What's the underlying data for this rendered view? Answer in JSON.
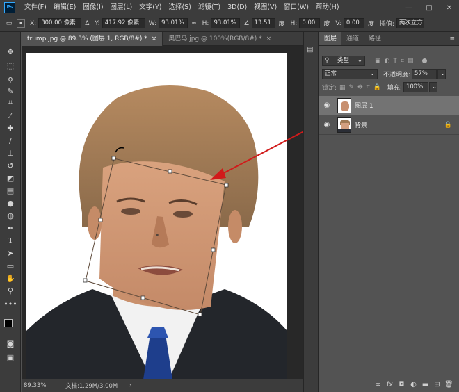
{
  "app": {
    "logo": "Ps"
  },
  "menu": [
    "文件(F)",
    "编辑(E)",
    "图像(I)",
    "图层(L)",
    "文字(Y)",
    "选择(S)",
    "滤镜(T)",
    "3D(D)",
    "视图(V)",
    "窗口(W)",
    "帮助(H)"
  ],
  "window_controls": {
    "minimize": "—",
    "maximize": "□",
    "close": "✕"
  },
  "options": {
    "x_label": "X:",
    "x_value": "300.00 像素",
    "delta_label": "Δ",
    "y_label": "Y:",
    "y_value": "417.92 像素",
    "w_label": "W:",
    "w_value": "93.01%",
    "link_icon": "∞",
    "h_label": "H:",
    "h_value": "93.01%",
    "angle_label": "∠",
    "angle_value": "13.51",
    "angle_unit": "度",
    "hskew_label": "H:",
    "hskew_value": "0.00",
    "hskew_unit": "度",
    "vskew_label": "V:",
    "vskew_value": "0.00",
    "vskew_unit": "度",
    "interp_label": "插值:",
    "interp_value": "两次立方"
  },
  "tabs": [
    {
      "label": "trump.jpg @ 89.3% (图层 1, RGB/8#) *",
      "close": "×",
      "active": true
    },
    {
      "label": "奥巴马.jpg @ 100%(RGB/8#) *",
      "close": "×",
      "active": false
    }
  ],
  "status": {
    "zoom": "89.33%",
    "doc": "文档:1.29M/3.00M",
    "arrow": "›"
  },
  "panel": {
    "tabs": [
      "图层",
      "通道",
      "路径"
    ],
    "menu_icon": "≡",
    "filter_label": "类型",
    "blend_mode": "正常",
    "opacity_label": "不透明度:",
    "opacity_value": "57%",
    "lock_label": "锁定:",
    "fill_label": "填充:",
    "fill_value": "100%",
    "layers": [
      {
        "name": "图层 1",
        "selected": true
      },
      {
        "name": "背景",
        "selected": false
      }
    ]
  },
  "colors": {
    "accent_arrow": "#d11a1a",
    "panel_bg": "#535353",
    "chrome_bg": "#3c3c3c"
  }
}
